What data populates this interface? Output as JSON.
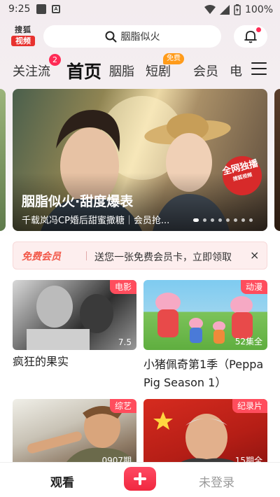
{
  "status_bar": {
    "time": "9:25",
    "battery": "100%"
  },
  "header": {
    "logo_top": "搜狐",
    "logo_bottom": "视频",
    "search_placeholder": "胭脂似火"
  },
  "tabs": [
    {
      "label": "关注流",
      "badge": "2"
    },
    {
      "label": "首页",
      "active": true
    },
    {
      "label": "胭脂"
    },
    {
      "label": "短剧",
      "badge": "免费"
    },
    {
      "label": "会员"
    },
    {
      "label": "电"
    }
  ],
  "hero": {
    "title": "胭脂似火·甜度爆表",
    "subtitle": "千载岚冯CP婚后甜蜜撒糖｜会员抢...",
    "stamp_main": "全网独播",
    "stamp_small": "搜狐视频",
    "dot_count": 8,
    "active_dot": 0
  },
  "vip_banner": {
    "tag": "免费会员",
    "text": "送您一张免费会员卡，立即领取",
    "close": "×"
  },
  "cards": [
    {
      "title": "疯狂的果实",
      "tag": "电影",
      "meta": "7.5"
    },
    {
      "title": "小猪佩奇第1季（Peppa Pig Season 1）",
      "tag": "动漫",
      "meta": "52集全"
    },
    {
      "title": "",
      "tag": "综艺",
      "meta": "0907期"
    },
    {
      "title": "",
      "tag": "纪录片",
      "meta": "15期全"
    }
  ],
  "bottom_nav": {
    "watch": "观看",
    "add": "+",
    "login": "未登录"
  },
  "colors": {
    "accent": "#ff2b55",
    "brand_red": "#e8322f",
    "free_orange": "#ff9b1a"
  }
}
